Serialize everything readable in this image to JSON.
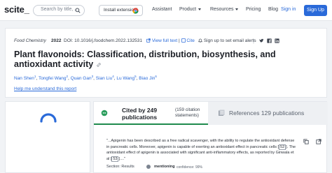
{
  "nav": {
    "logo": "scite_",
    "search_placeholder": "Search by title, ...",
    "extension_label": "Install extension!",
    "assistant": "Assistant",
    "product": "Product",
    "resources": "Resources",
    "pricing": "Pricing",
    "blog": "Blog",
    "sign_in": "Sign in",
    "sign_up": "Sign Up"
  },
  "paper": {
    "journal": "Food Chemistry",
    "year": "2022",
    "doi": "DOI: 10.1016/j.foodchem.2022.132531",
    "view_full_text": "View full text",
    "cite": "Cite",
    "alert": "Sign up to set email alerts",
    "title": "Plant flavonoids: Classification, distribution, biosynthesis, and antioxidant activity",
    "authors": [
      {
        "name": "Nan Shen",
        "sup": "1"
      },
      {
        "name": "Tongfei Wang",
        "sup": "2"
      },
      {
        "name": "Quan Gan",
        "sup": "3"
      },
      {
        "name": "Sian Liu",
        "sup": "4"
      },
      {
        "name": "Lu Wang",
        "sup": "5"
      },
      {
        "name": "Biao Jin",
        "sup": "6"
      }
    ],
    "help": "Help me understand this report"
  },
  "citations": {
    "cited_by": "Cited by 249 publications",
    "statements": "(159 citation statements)",
    "references": "References 129 publications",
    "snippet_before": "\"...Apigenin has been described as a free radical scavenger, with the ability to regulate the antioxidant defense in pancreatic cells. Moreover, apigenin is capable of exerting an antioxidant effect in pancreatic cells [",
    "ref1": " 52 ",
    "snippet_middle": "]. The antioxidant effect of apigenin is associated with significant anti-inflammatory effects, as reported by Ginwala et al [",
    "ref2": " 53 ",
    "snippet_after": "]....\"",
    "section": "Section: Results",
    "mention": "mentioning",
    "confidence": "confidence: 99%"
  },
  "colors": {
    "accent": "#2a6ad9",
    "tab_active": "#1f8a4c"
  }
}
